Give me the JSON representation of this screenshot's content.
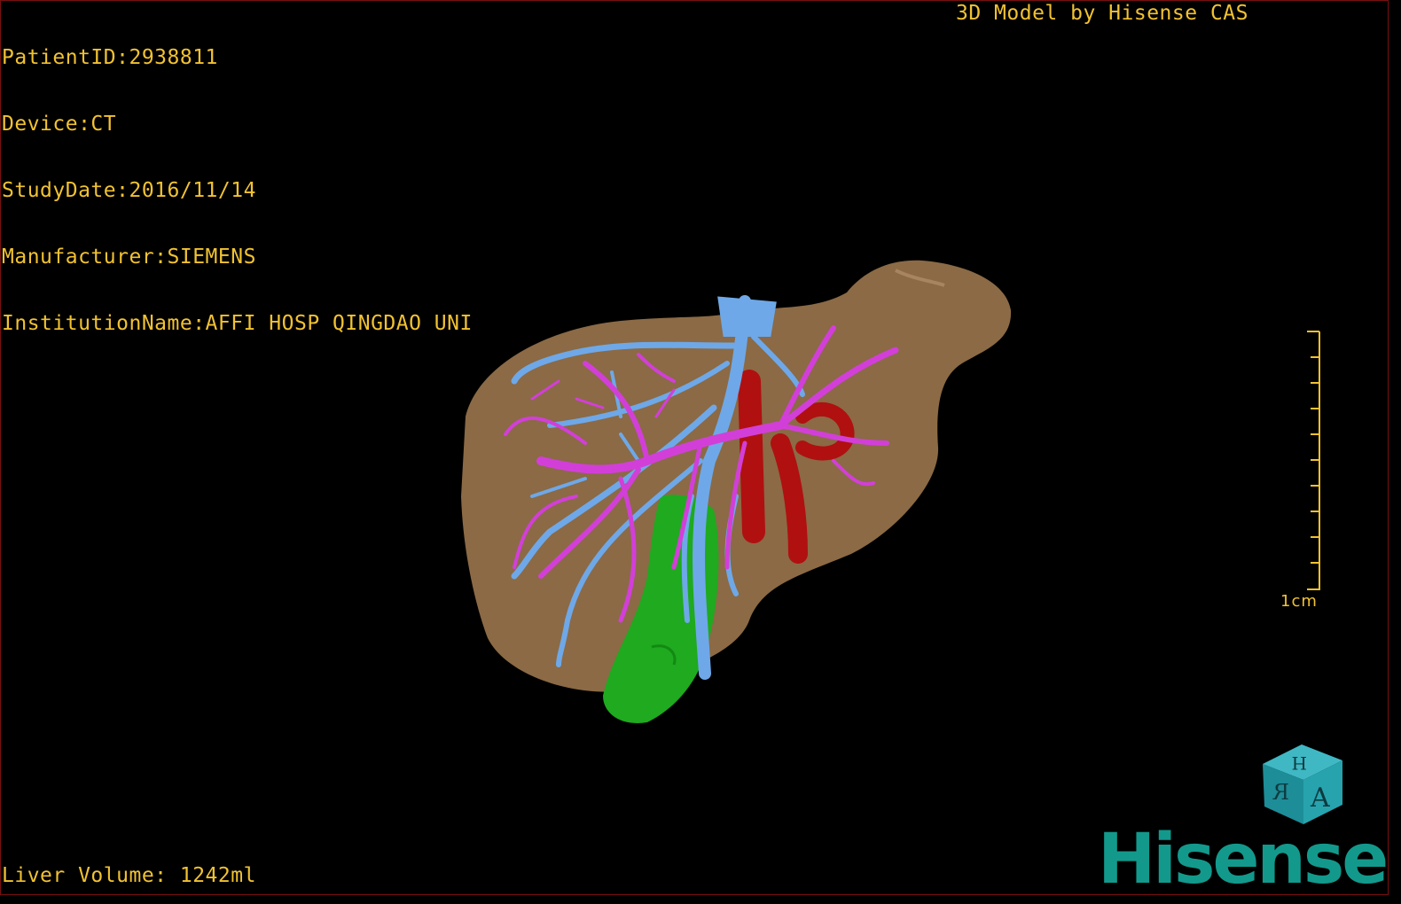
{
  "header": {
    "patient_id": "PatientID:2938811",
    "device": "Device:CT",
    "study_date": "StudyDate:2016/11/14",
    "manufacturer": "Manufacturer:SIEMENS",
    "institution": "InstitutionName:AFFI HOSP QINGDAO UNI",
    "model_credit": "3D Model by Hisense CAS"
  },
  "footer": {
    "liver_volume": "Liver Volume: 1242ml"
  },
  "scale_bar": {
    "label": "1cm"
  },
  "orientation_cube": {
    "front_letter": "A",
    "top_letter": "H",
    "side_letter": "R"
  },
  "brand": {
    "logo_text": "Hisense"
  },
  "colors": {
    "overlay_text": "#f1c232",
    "liver": "#8b6a45",
    "hepatic_vein": "#6ea8e8",
    "portal_vein": "#d23fd8",
    "artery": "#b01010",
    "vena_cava": "#1faa1f",
    "brand": "#12998c"
  }
}
